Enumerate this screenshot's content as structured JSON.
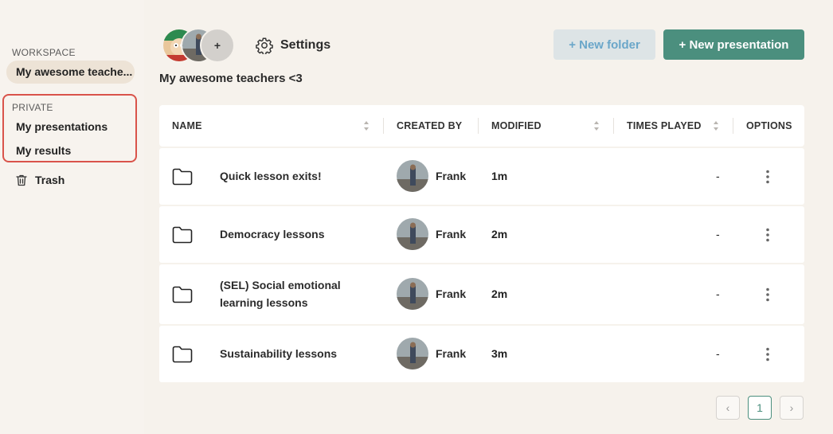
{
  "sidebar": {
    "workspace_label": "WORKSPACE",
    "workspace_item": "My awesome teache...",
    "private_label": "PRIVATE",
    "private_items": [
      "My presentations",
      "My results"
    ],
    "trash_label": "Trash",
    "highlight_color": "#d9534a"
  },
  "header": {
    "avatar_add": "+",
    "settings_label": "Settings",
    "new_folder_label": "+ New folder",
    "new_presentation_label": "+ New presentation",
    "workspace_title": "My awesome teachers <3"
  },
  "table": {
    "columns": [
      "NAME",
      "CREATED BY",
      "MODIFIED",
      "TIMES PLAYED",
      "OPTIONS"
    ],
    "rows": [
      {
        "name": "Quick lesson exits!",
        "creator": "Frank",
        "modified": "1m",
        "played": "-"
      },
      {
        "name": "Democracy lessons",
        "creator": "Frank",
        "modified": "2m",
        "played": "-"
      },
      {
        "name": "(SEL) Social emotional learning lessons",
        "creator": "Frank",
        "modified": "2m",
        "played": "-"
      },
      {
        "name": "Sustainability lessons",
        "creator": "Frank",
        "modified": "3m",
        "played": "-"
      }
    ]
  },
  "pagination": {
    "prev": "‹",
    "current": "1",
    "next": "›"
  },
  "colors": {
    "accent": "#4b8f7e",
    "secondary_button_bg": "#dde4e6",
    "secondary_button_text": "#6aa6c9"
  }
}
